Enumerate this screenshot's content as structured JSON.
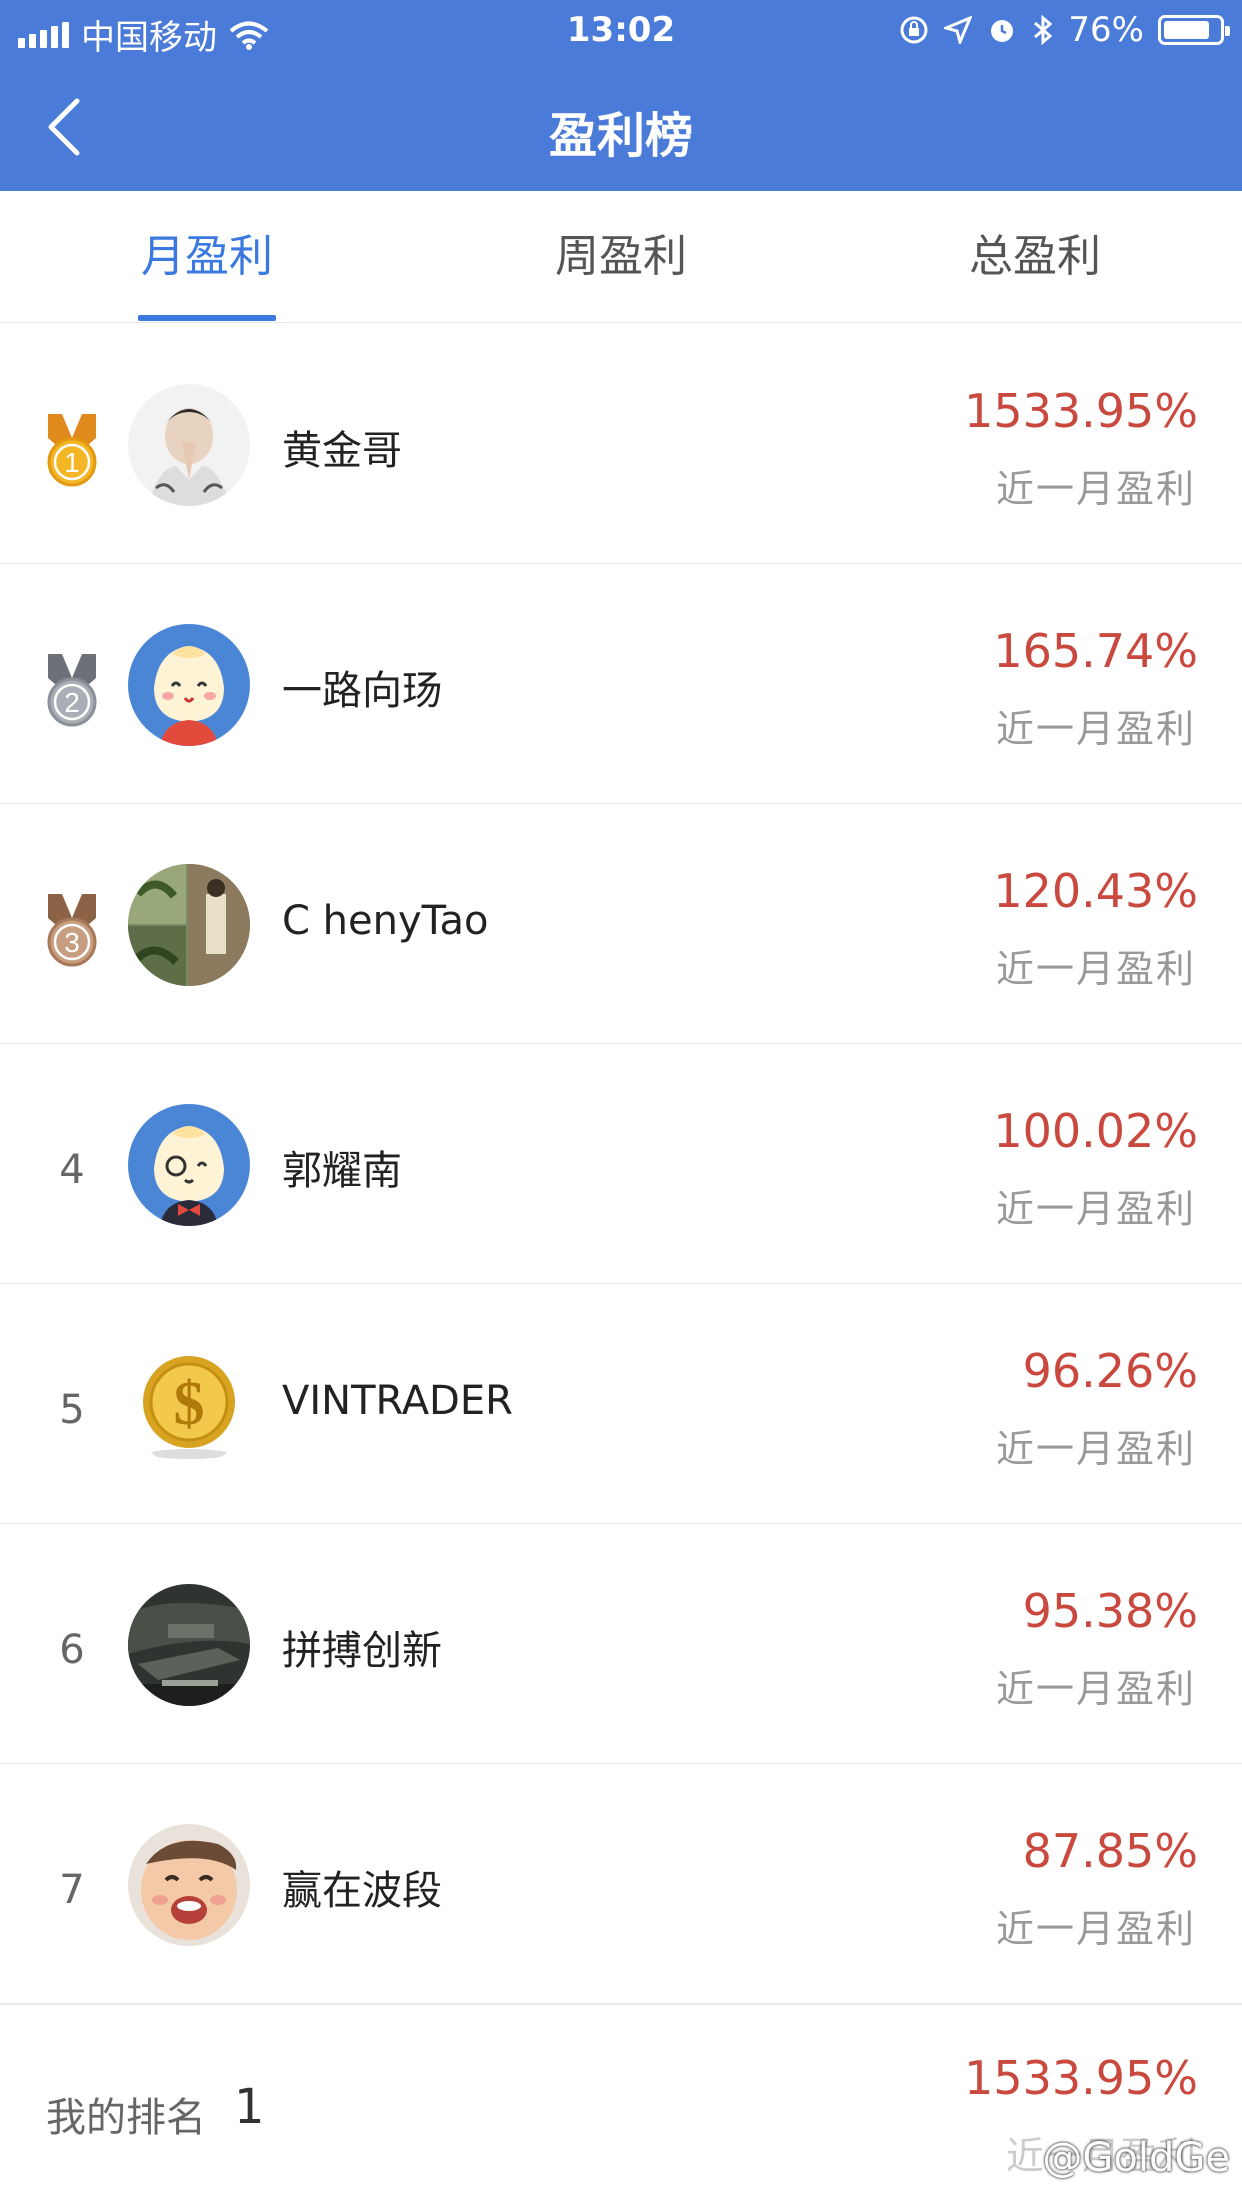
{
  "status_bar": {
    "carrier": "中国移动",
    "time": "13:02",
    "battery": "76%",
    "battery_level": 0.76
  },
  "navbar": {
    "title": "盈利榜"
  },
  "tabs": [
    {
      "label": "月盈利",
      "active": true
    },
    {
      "label": "周盈利",
      "active": false
    },
    {
      "label": "总盈利",
      "active": false
    }
  ],
  "rows": [
    {
      "rank": "1",
      "medal": "gold",
      "name": "黄金哥",
      "pct": "1533.95%",
      "sub": "近一月盈利"
    },
    {
      "rank": "2",
      "medal": "silver",
      "name": "一路向玚",
      "pct": "165.74%",
      "sub": "近一月盈利"
    },
    {
      "rank": "3",
      "medal": "bronze",
      "name": "C henyTao",
      "pct": "120.43%",
      "sub": "近一月盈利"
    },
    {
      "rank": "4",
      "name": "郭耀南",
      "pct": "100.02%",
      "sub": "近一月盈利"
    },
    {
      "rank": "5",
      "name": "VINTRADER",
      "pct": "96.26%",
      "sub": "近一月盈利"
    },
    {
      "rank": "6",
      "name": "拼搏创新",
      "pct": "95.38%",
      "sub": "近一月盈利"
    },
    {
      "rank": "7",
      "name": "赢在波段",
      "pct": "87.85%",
      "sub": "近一月盈利"
    }
  ],
  "footer": {
    "my_rank_label": "我的排名",
    "my_rank_value": "1",
    "pct": "1533.95%",
    "sub": "近一月盈利",
    "watermark": "@GoldGe"
  },
  "colors": {
    "nav_bg": "#4a7bd8",
    "accent": "#3b78e0",
    "profit_red": "#c9493f",
    "gold": "#e08a1e",
    "silver": "#8a8f98",
    "bronze": "#a8785a"
  }
}
